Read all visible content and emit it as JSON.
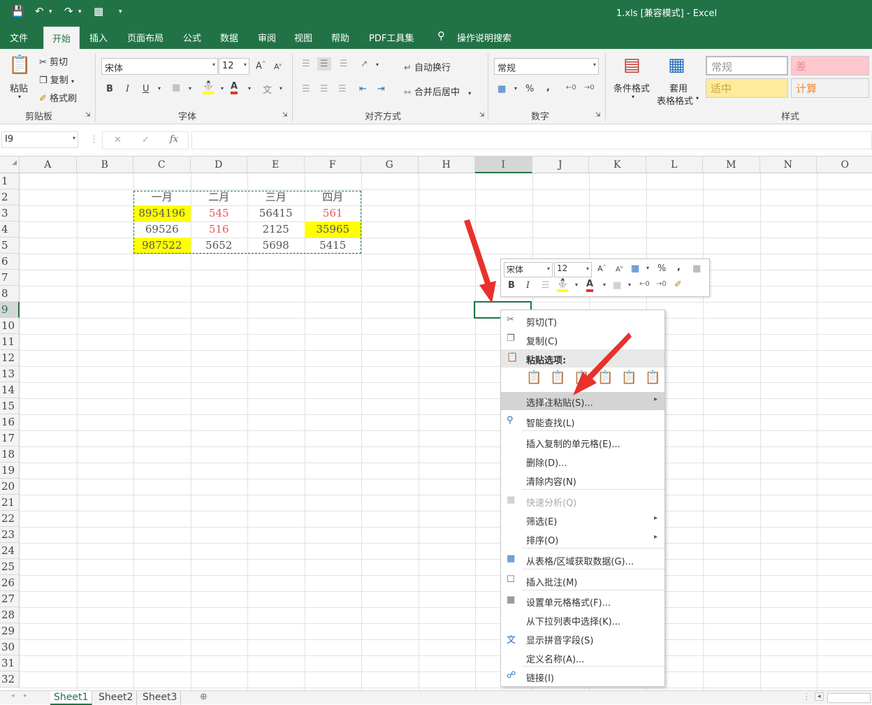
{
  "window": {
    "title": "1.xls  [兼容模式]  -  Excel"
  },
  "quick_access": {
    "save_icon": "save-icon",
    "undo_icon": "undo-icon",
    "redo_icon": "redo-icon",
    "preview_icon": "print-preview-icon"
  },
  "tabs": [
    {
      "label": "文件"
    },
    {
      "label": "开始"
    },
    {
      "label": "插入"
    },
    {
      "label": "页面布局"
    },
    {
      "label": "公式"
    },
    {
      "label": "数据"
    },
    {
      "label": "审阅"
    },
    {
      "label": "视图"
    },
    {
      "label": "帮助"
    },
    {
      "label": "PDF工具集"
    },
    {
      "label": "操作说明搜索"
    }
  ],
  "ribbon": {
    "clipboard": {
      "paste": "粘贴",
      "cut": "剪切",
      "copy": "复制",
      "format_painter": "格式刷",
      "group": "剪贴板"
    },
    "font": {
      "name": "宋体",
      "size": "12",
      "bold": "B",
      "italic": "I",
      "underline": "U",
      "group": "字体"
    },
    "alignment": {
      "wrap": "自动换行",
      "merge": "合并后居中",
      "group": "对齐方式"
    },
    "number": {
      "format": "常规",
      "percent": "%",
      "comma": ",",
      "group": "数字"
    },
    "styles": {
      "conditional": "条件格式",
      "table_format_1": "套用",
      "table_format_2": "表格格式",
      "normal": "常规",
      "bad": "差",
      "neutral": "适中",
      "calc": "计算",
      "group": "样式"
    }
  },
  "formula_bar": {
    "name_box": "I9",
    "fx": "fx",
    "cancel": "✕",
    "enter": "✓"
  },
  "columns": [
    "A",
    "B",
    "C",
    "D",
    "E",
    "F",
    "G",
    "H",
    "I",
    "J",
    "K",
    "L",
    "M",
    "N",
    "O"
  ],
  "rows": [
    "1",
    "2",
    "3",
    "4",
    "5",
    "6",
    "7",
    "8",
    "9",
    "10",
    "11",
    "12",
    "13",
    "14",
    "15",
    "16",
    "17",
    "18",
    "19",
    "20",
    "21",
    "22",
    "23",
    "24",
    "25",
    "26",
    "27",
    "28",
    "29",
    "30",
    "31",
    "32"
  ],
  "table": {
    "headers": [
      "一月",
      "二月",
      "三月",
      "四月"
    ],
    "rows": [
      [
        "8954196",
        "545",
        "56415",
        "561"
      ],
      [
        "69526",
        "516",
        "2125",
        "35965"
      ],
      [
        "987522",
        "5652",
        "5698",
        "5415"
      ]
    ],
    "highlight_color": "#ffff00",
    "red_text_color": "#e8555a"
  },
  "mini_toolbar": {
    "font": "宋体",
    "size": "12",
    "bold": "B",
    "italic": "I",
    "percent": "%",
    "comma": ","
  },
  "context_menu": {
    "items": [
      {
        "label": "剪切(T)",
        "icon": "scissors-icon"
      },
      {
        "label": "复制(C)",
        "icon": "copy-icon"
      },
      {
        "label": "粘贴选项:",
        "icon": "paste-icon"
      },
      {
        "label": "选择性粘贴(S)...",
        "icon": ""
      },
      {
        "label": "智能查找(L)",
        "icon": "search-icon"
      },
      {
        "label": "插入复制的单元格(E)...",
        "icon": ""
      },
      {
        "label": "删除(D)...",
        "icon": ""
      },
      {
        "label": "清除内容(N)",
        "icon": ""
      },
      {
        "label": "快速分析(Q)",
        "icon": "quick-analysis-icon"
      },
      {
        "label": "筛选(E)",
        "icon": ""
      },
      {
        "label": "排序(O)",
        "icon": ""
      },
      {
        "label": "从表格/区域获取数据(G)...",
        "icon": "table-icon"
      },
      {
        "label": "插入批注(M)",
        "icon": "comment-icon"
      },
      {
        "label": "设置单元格格式(F)...",
        "icon": "format-cells-icon"
      },
      {
        "label": "从下拉列表中选择(K)...",
        "icon": ""
      },
      {
        "label": "显示拼音字段(S)",
        "icon": "phonetic-icon"
      },
      {
        "label": "定义名称(A)...",
        "icon": ""
      },
      {
        "label": "链接(I)",
        "icon": "link-icon"
      }
    ]
  },
  "sheets": [
    {
      "label": "Sheet1"
    },
    {
      "label": "Sheet2"
    },
    {
      "label": "Sheet3"
    }
  ],
  "accent": "#217346",
  "arrow_color": "#e8312c"
}
